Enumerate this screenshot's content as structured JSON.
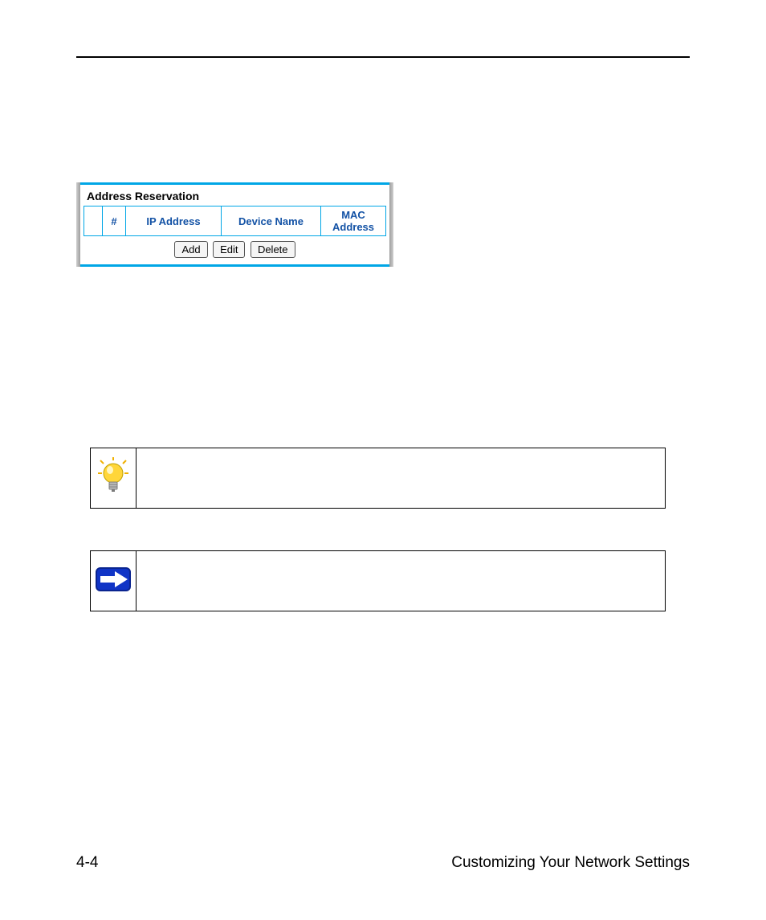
{
  "panel": {
    "title": "Address Reservation",
    "columns": {
      "tick": "",
      "hash": "#",
      "ip": "IP Address",
      "device": "Device Name",
      "mac": "MAC Address"
    },
    "buttons": {
      "add": "Add",
      "edit": "Edit",
      "delete": "Delete"
    }
  },
  "callouts": {
    "tip_icon_alt": "lightbulb-icon",
    "note_icon_alt": "arrow-icon"
  },
  "footer": {
    "page": "4-4",
    "section": "Customizing Your Network Settings"
  }
}
